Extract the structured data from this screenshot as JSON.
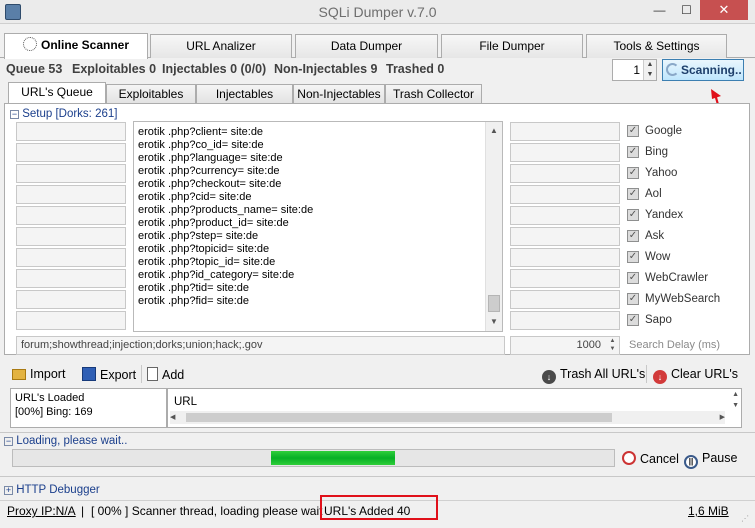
{
  "window": {
    "title": "SQLi Dumper v.7.0",
    "minimize_glyph": "—",
    "maximize_glyph": "☐",
    "close_glyph": "✕"
  },
  "main_tabs": [
    {
      "label": "Online Scanner"
    },
    {
      "label": "URL Analizer"
    },
    {
      "label": "Data Dumper"
    },
    {
      "label": "File Dumper"
    },
    {
      "label": "Tools & Settings"
    }
  ],
  "stats": {
    "queue": "Queue 53",
    "exploitables": "Exploitables 0",
    "injectables": "Injectables 0 (0/0)",
    "non_injectables": "Non-Injectables 9",
    "trashed": "Trashed 0"
  },
  "threads_value": "1",
  "scan_button": "Scanning..",
  "sub_tabs": [
    {
      "label": "URL's Queue"
    },
    {
      "label": "Exploitables"
    },
    {
      "label": "Injectables"
    },
    {
      "label": "Non-Injectables"
    },
    {
      "label": "Trash Collector"
    }
  ],
  "setup_label": "Setup [Dorks: 261]",
  "collapse_glyph": "−",
  "expand_glyph": "+",
  "dorks": [
    "erotik .php?client= site:de",
    "erotik .php?co_id= site:de",
    "erotik .php?language= site:de",
    "erotik .php?currency= site:de",
    "erotik .php?checkout= site:de",
    "erotik .php?cid= site:de",
    "erotik .php?products_name= site:de",
    "erotik .php?product_id= site:de",
    "erotik .php?step= site:de",
    "erotik .php?topicid= site:de",
    "erotik .php?topic_id= site:de",
    "erotik .php?id_category= site:de",
    "erotik .php?tid= site:de",
    "erotik .php?fid= site:de"
  ],
  "engines": [
    {
      "name": "Google",
      "checked": true
    },
    {
      "name": "Bing",
      "checked": true
    },
    {
      "name": "Yahoo",
      "checked": true
    },
    {
      "name": "Aol",
      "checked": true
    },
    {
      "name": "Yandex",
      "checked": true
    },
    {
      "name": "Ask",
      "checked": true
    },
    {
      "name": "Wow",
      "checked": true
    },
    {
      "name": "WebCrawler",
      "checked": true
    },
    {
      "name": "MyWebSearch",
      "checked": true
    },
    {
      "name": "Sapo",
      "checked": true
    }
  ],
  "check_glyph": "✓",
  "exclude_keywords": "forum;showthread;injection;dorks;union;hack;.gov",
  "search_delay_value": "1000",
  "search_delay_label": "Search Delay (ms)",
  "toolbar": {
    "import": "Import",
    "export": "Export",
    "add": "Add",
    "trash_all": "Trash All URL's",
    "clear": "Clear URL's"
  },
  "urls_loaded": {
    "title": "URL's Loaded",
    "detail": "[00%] Bing: 169"
  },
  "url_column": "URL",
  "loading_label": "Loading, please wait..",
  "progress": {
    "start_fraction": 0.43,
    "end_fraction": 0.637
  },
  "controls": {
    "cancel": "Cancel",
    "pause": "Pause"
  },
  "http_debugger": "HTTP Debugger",
  "status": {
    "proxy": "Proxy IP:N/A",
    "separator": "|",
    "scanner": "[ 00% ] Scanner thread, loading please wait",
    "urls_added": "URL's Added 40",
    "memory": "1,6 MiB"
  },
  "colors": {
    "progress": "#06b025",
    "highlight": "#e0101a",
    "link": "#1b3f8c",
    "close": "#c75050"
  }
}
